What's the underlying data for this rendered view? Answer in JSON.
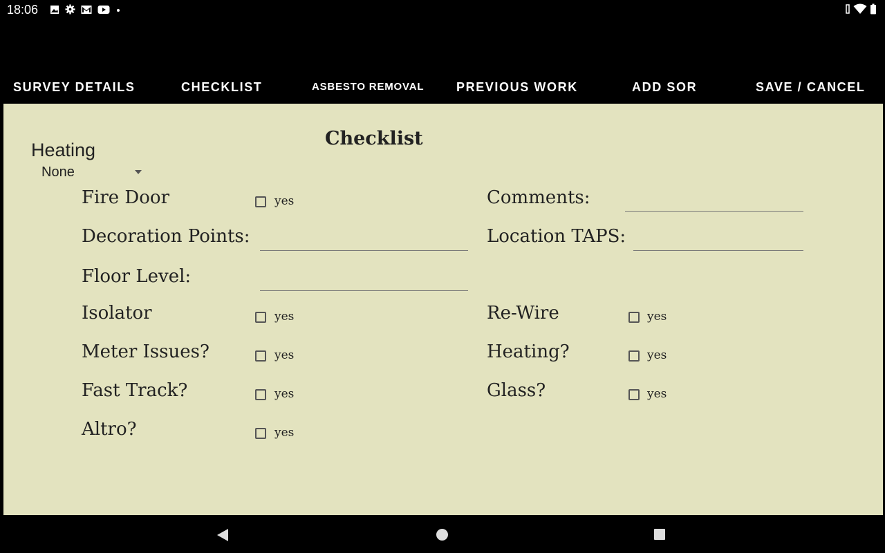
{
  "status_bar": {
    "time": "18:06",
    "icons": [
      "image-icon",
      "settings-gear-icon",
      "gmail-icon",
      "youtube-icon",
      "dot-icon"
    ],
    "right_icons": [
      "vibrate-icon",
      "wifi-icon",
      "battery-icon"
    ]
  },
  "tabs": [
    {
      "label": "SURVEY DETAILS"
    },
    {
      "label": "CHECKLIST"
    },
    {
      "label": "ASBESTO REMOVAL"
    },
    {
      "label": "PREVIOUS WORK"
    },
    {
      "label": "ADD SOR"
    },
    {
      "label": "SAVE / CANCEL"
    }
  ],
  "form": {
    "title": "Checklist",
    "heating_heading": "Heating",
    "heating_select": "None",
    "yes_label": "yes",
    "fire_door": "Fire Door",
    "decoration_points": "Decoration Points:",
    "floor_level": "Floor Level:",
    "isolator": "Isolator",
    "meter_issues": "Meter Issues?",
    "fast_track": "Fast Track?",
    "altro": "Altro?",
    "comments": "Comments:",
    "location_taps": "Location TAPS:",
    "re_wire": "Re-Wire",
    "heating_q": "Heating?",
    "glass": "Glass?"
  },
  "nav": [
    "back-icon",
    "home-icon",
    "recents-icon"
  ]
}
